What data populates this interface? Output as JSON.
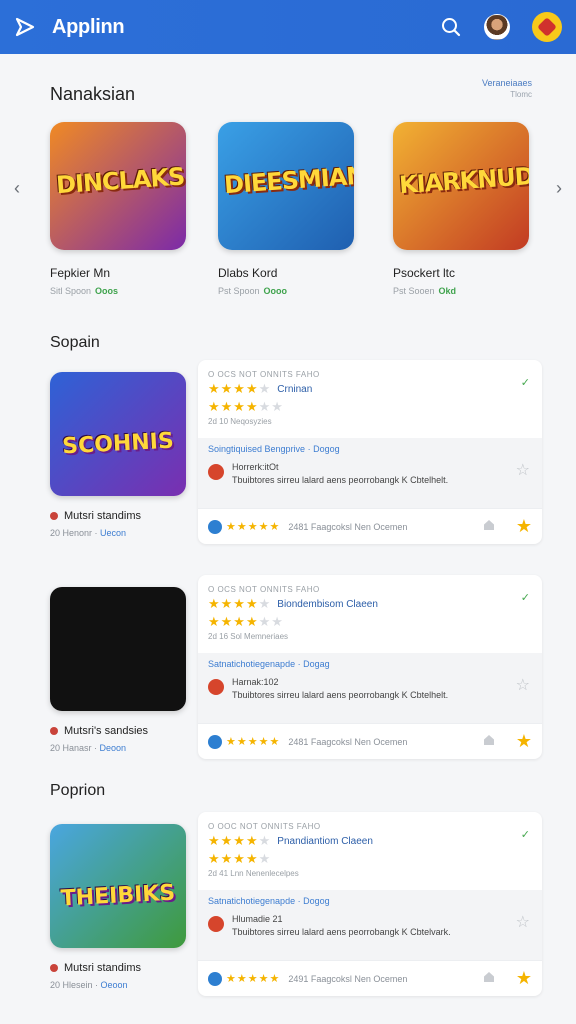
{
  "app": {
    "title": "Applinn"
  },
  "sections": {
    "featured_title": "Nanaksian",
    "see_all": "Veraneiaaes",
    "see_all_sub": "Tlomc",
    "s2_title": "Sopain",
    "s3_title": "Poprion"
  },
  "featured": [
    {
      "word": "DINCLAKS",
      "name": "Fepkier Mn",
      "meta": "Sitl Spoon",
      "tag": "Ooos",
      "colors": [
        "#f08a24",
        "#7c2aa8"
      ]
    },
    {
      "word": "DIEESMIAN",
      "name": "Dlabs Kord",
      "meta": "Pst Spoon",
      "tag": "Oooo",
      "colors": [
        "#3aa0e6",
        "#1f5fb0"
      ]
    },
    {
      "word": "KIARKNUD",
      "name": "Psockert ltc",
      "meta": "Pst Sooen",
      "tag": "Okd",
      "colors": [
        "#f2b233",
        "#c23b23"
      ]
    }
  ],
  "cards": [
    {
      "thumb_word": "SCOHNIS",
      "thumb_colors": [
        "#2e62d6",
        "#7a2fb0"
      ],
      "caption": "Mutsri standims",
      "sub_a": "20 Henonr",
      "sub_b": "Uecon",
      "label": "O OCS NOT ONNITS FAHO",
      "title": "Crninan",
      "subline": "2d 10 Neqosyzies",
      "stars": "★★★★",
      "stars_off": "★",
      "stars2": "★★★★",
      "stars2_off": "★★",
      "link": "Soingtiquised Bengprive · Dogog",
      "review_head": "Horrerk:itOt",
      "review_body": "Tbuibtores sirreu lalard aens peorrobangk K Cbtelhelt.",
      "bottom_stars": "★★★★★",
      "bottom_text": "2481 Faagcoksl Nen Ocemen"
    },
    {
      "thumb_word": "",
      "thumb_colors": [
        "#111111",
        "#111111"
      ],
      "caption": "Mutsri's sandsies",
      "sub_a": "20 Hanasr",
      "sub_b": "Deoon",
      "label": "O OCS NOT ONNITS FAHO",
      "title": "Biondembisom Claeen",
      "subline": "2d 16 Sol Memneriaes",
      "stars": "★★★★",
      "stars_off": "★",
      "stars2": "★★★★",
      "stars2_off": "★★",
      "link": "Satnatichotiegenapde · Dogag",
      "review_head": "Harnak:102",
      "review_body": "Tbuibtores sirreu lalard aens peorrobangk K Cbtelhelt.",
      "bottom_stars": "★★★★★",
      "bottom_text": "2481 Faagcoksl Nen Ocemen"
    },
    {
      "thumb_word": "THEIBIKS",
      "thumb_colors": [
        "#4aa6e0",
        "#3f9a3c"
      ],
      "caption": "Mutsri standims",
      "sub_a": "20 Hlesein",
      "sub_b": "Oeoon",
      "label": "O OOC NOT ONNITS FAHO",
      "title": "Pnandiantiom Claeen",
      "subline": "2d 41 Lnn Nenenlecelpes",
      "stars": "★★★★",
      "stars_off": "★",
      "stars2": "★★★★",
      "stars2_off": "★",
      "link": "Satnatichotiegenapde · Dogog",
      "review_head": "Hlumadie 21",
      "review_body": "Tbuibtores sirreu lalard aens peorrobangk K Cbtelvark.",
      "bottom_stars": "★★★★★",
      "bottom_text": "2491 Faagcoksl Nen Ocemen"
    }
  ]
}
